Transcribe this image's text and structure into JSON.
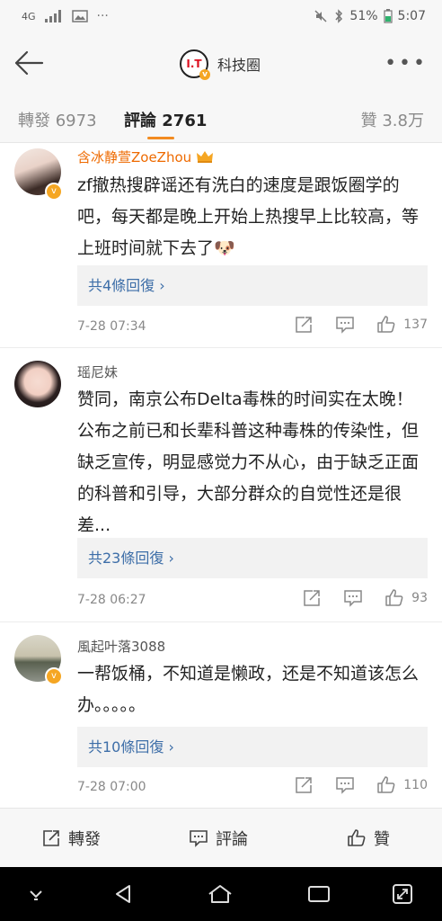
{
  "status": {
    "network": "4G",
    "battery": "51%",
    "time": "5:07",
    "icons": [
      "signal-icon",
      "gallery-icon",
      "more-dots-icon",
      "mute-icon",
      "bluetooth-icon",
      "battery-icon"
    ]
  },
  "nav": {
    "title": "科技圈",
    "logo_text": "I.T",
    "back_icon": "back-arrow-icon",
    "more_icon": "more-icon"
  },
  "tabs": [
    {
      "label": "轉發",
      "count": "6973"
    },
    {
      "label": "評論",
      "count": "2761",
      "active": true
    },
    {
      "label": "贊",
      "count": "3.8万"
    }
  ],
  "comments": [
    {
      "username": "含冰静萱ZoeZhou",
      "user_badge": "crown-icon",
      "text": "zf撤热搜辟谣还有洗白的速度是跟饭圈学的吧，每天都是晚上开始上热搜早上比较高，等上班时间就下去了🐶",
      "replies": "共4條回復 ›",
      "time": "7-28 07:34",
      "likes": "137"
    },
    {
      "username": "瑶尼妹",
      "text": "赞同，南京公布Delta毒株的时间实在太晚！公布之前已和长辈科普这种毒株的传染性，但缺乏宣传，明显感觉力不从心，由于缺乏正面的科普和引导，大部分群众的自觉性还是很差...",
      "replies": "共23條回復 ›",
      "time": "7-28 06:27",
      "likes": "93"
    },
    {
      "username": "風起叶落3088",
      "text": "一帮饭桶，不知道是懒政，还是不知道该怎么办。。。。。",
      "replies": "共10條回復 ›",
      "time": "7-28 07:00",
      "likes": "110"
    }
  ],
  "bottom": {
    "repost": "轉發",
    "comment": "評論",
    "like": "贊"
  },
  "colors": {
    "accent": "#f28b20",
    "link": "#3d6ea8",
    "vip_name": "#ee6a00"
  }
}
